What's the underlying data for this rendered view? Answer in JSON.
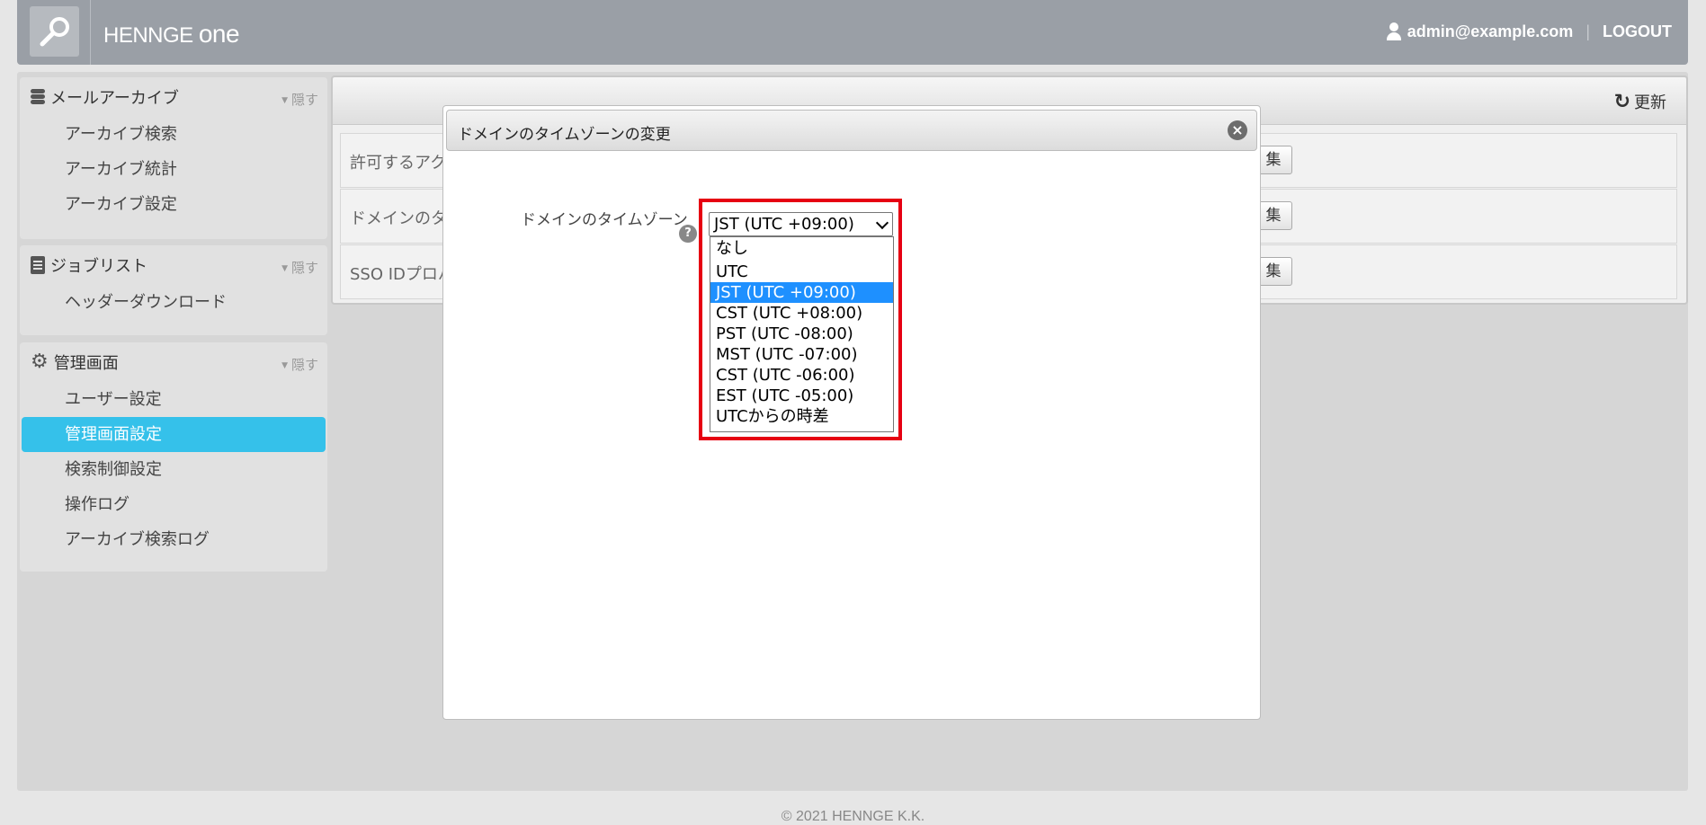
{
  "header": {
    "brand_prefix": "HENNGE",
    "brand_suffix": "one",
    "user_email": "admin@example.com",
    "logout_label": "LOGOUT"
  },
  "sidebar": {
    "hide_label": "隠す",
    "sections": [
      {
        "title": "メールアーカイブ",
        "items": [
          "アーカイブ検索",
          "アーカイブ統計",
          "アーカイブ設定"
        ]
      },
      {
        "title": "ジョブリスト",
        "items": [
          "ヘッダーダウンロード"
        ]
      },
      {
        "title": "管理画面",
        "items": [
          "ユーザー設定",
          "管理画面設定",
          "検索制御設定",
          "操作ログ",
          "アーカイブ検索ログ"
        ],
        "active": "管理画面設定"
      }
    ]
  },
  "panel": {
    "refresh_label": "更新",
    "rows": [
      {
        "label": "許可するアク",
        "edit_label": "集"
      },
      {
        "label": "ドメインのタ",
        "edit_label": "集"
      },
      {
        "label": "SSO IDプロバ",
        "edit_label": "集"
      }
    ]
  },
  "modal": {
    "title": "ドメインのタイムゾーンの変更",
    "field_label": "ドメインのタイムゾーン",
    "help_glyph": "?",
    "selected_value": "JST (UTC +09:00)",
    "options": [
      "なし",
      "UTC",
      "JST (UTC +09:00)",
      "CST (UTC +08:00)",
      "PST (UTC -08:00)",
      "MST (UTC -07:00)",
      "CST (UTC -06:00)",
      "EST (UTC -05:00)",
      "UTCからの時差"
    ],
    "selected_index": 2
  },
  "footer": {
    "copyright": "© 2021 HENNGE K.K."
  },
  "colors": {
    "header_bg": "#9a9fa6",
    "active_item": "#35c1ea",
    "highlight_border": "#e60012",
    "option_selected": "#1e90ff"
  },
  "icons": [
    "search-logo-icon",
    "user-icon",
    "database-icon",
    "clipboard-icon",
    "gear-icon",
    "refresh-icon",
    "close-icon",
    "help-icon",
    "chevron-down-icon"
  ]
}
